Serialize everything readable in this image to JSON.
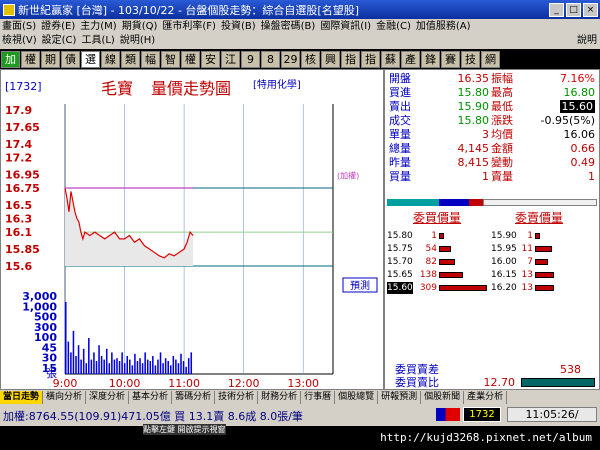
{
  "window": {
    "title": "新世紀贏家 [台灣] - 103/10/22 - 台盤個股走勢：綜合自選股[名望股]",
    "btn_min": "_",
    "btn_max": "□",
    "btn_close": "×"
  },
  "menu": {
    "row1": [
      "畫面(S)",
      "證券(E)",
      "主力(M)",
      "期貨(Q)",
      "匯市利率(F)",
      "投資(B)",
      "操盤密碼(B)",
      "國際資訊(I)",
      "金融(C)",
      "加值服務(A)"
    ],
    "row2": [
      "檢視(V)",
      "設定(C)",
      "工具(L)",
      "說明(H)"
    ],
    "help": "說明"
  },
  "toolbar": {
    "items": [
      "加",
      "權",
      "期",
      "債",
      "選",
      "線",
      "類",
      "幅",
      "智",
      "權",
      "安",
      "江",
      "9",
      "8",
      "29",
      "核",
      "興",
      "指",
      "指",
      "蘇",
      "產",
      "鋒",
      "賽",
      "技",
      "網"
    ],
    "selected_index": 4,
    "green_items": [
      0
    ]
  },
  "chart_area": {
    "stock_code": "[1732]",
    "stock_name": "毛寶",
    "chart_title": "量價走勢圖",
    "industry": "[特用化學]",
    "limit_up_label": "(加權)",
    "forecast_label": "預測",
    "vol_unit": "張"
  },
  "chart_data": {
    "type": "line",
    "price_axis": {
      "ticks": [
        17.9,
        17.65,
        17.4,
        17.2,
        16.95,
        16.75,
        16.5,
        16.3,
        16.1,
        15.85,
        15.6
      ],
      "ylim": [
        15.6,
        17.9
      ],
      "reference": 16.1,
      "limit_up_line": 16.75,
      "limit_down_line": 15.6
    },
    "volume_axis": {
      "ticks": [
        "3,000",
        "1,000",
        "500",
        "300",
        "100",
        "45",
        "30",
        "15"
      ],
      "ylim": [
        0,
        3000
      ]
    },
    "time_axis": {
      "ticks": [
        "9:00",
        "10:00",
        "11:00",
        "12:00",
        "13:00"
      ],
      "xlim": [
        "9:00",
        "13:30"
      ]
    },
    "series": [
      {
        "name": "price",
        "color": "#e00000",
        "x": [
          "9:00",
          "9:02",
          "9:04",
          "9:06",
          "9:08",
          "9:10",
          "9:12",
          "9:14",
          "9:16",
          "9:18",
          "9:20",
          "9:25",
          "9:30",
          "9:35",
          "9:40",
          "9:45",
          "9:50",
          "9:55",
          "10:00",
          "10:05",
          "10:10",
          "10:15",
          "10:20",
          "10:25",
          "10:30",
          "10:35",
          "10:40",
          "10:45",
          "10:50",
          "10:55",
          "11:00",
          "11:03",
          "11:06",
          "11:09"
        ],
        "values": [
          16.75,
          16.6,
          16.4,
          16.7,
          16.55,
          16.4,
          16.3,
          16.25,
          16.1,
          16.0,
          16.1,
          16.05,
          16.1,
          16.05,
          16.0,
          16.05,
          16.1,
          16.0,
          16.0,
          16.05,
          15.95,
          16.0,
          15.9,
          15.85,
          15.8,
          15.75,
          15.72,
          15.78,
          15.75,
          15.8,
          15.85,
          15.95,
          16.1,
          16.05
        ]
      },
      {
        "name": "average",
        "color": "#c040c0",
        "x": [
          "9:00",
          "11:09"
        ],
        "values": [
          16.75,
          16.75
        ]
      }
    ],
    "volume": {
      "color": "#0000e0",
      "x_range": [
        "9:00",
        "11:09"
      ],
      "heights_rel": [
        1.0,
        0.45,
        0.3,
        0.6,
        0.25,
        0.4,
        0.2,
        0.35,
        0.15,
        0.5,
        0.2,
        0.3,
        0.18,
        0.4,
        0.25,
        0.2,
        0.35,
        0.15,
        0.3,
        0.2,
        0.22,
        0.18,
        0.3,
        0.15,
        0.25,
        0.2,
        0.12,
        0.28,
        0.18,
        0.22,
        0.15,
        0.3,
        0.2,
        0.18,
        0.25,
        0.12,
        0.2,
        0.3,
        0.15,
        0.22,
        0.18,
        0.12,
        0.25,
        0.2,
        0.15,
        0.28,
        0.18,
        0.1,
        0.22,
        0.3
      ]
    }
  },
  "quote": {
    "rows": [
      {
        "l1": "開盤",
        "v1": "16.35",
        "l2": "振幅",
        "v2": "7.16%",
        "c1": "#c00000",
        "c2": "#e00000"
      },
      {
        "l1": "買進",
        "v1": "15.80",
        "l2": "最高",
        "v2": "16.80",
        "c1": "#009000",
        "c2": "#009000"
      },
      {
        "l1": "賣出",
        "v1": "15.90",
        "l2": "最低",
        "v2": "15.60",
        "c1": "#009000",
        "c2": "#ffffff"
      },
      {
        "l1": "成交",
        "v1": "15.80",
        "l2": "漲跌",
        "v2": "-0.95(5%)",
        "c1": "#009000",
        "c2": "#000000"
      },
      {
        "l1": "單量",
        "v1": "3",
        "l2": "均價",
        "v2": "16.06",
        "c1": "#c00000",
        "c2": "#000000"
      },
      {
        "l1": "總量",
        "v1": "4,145",
        "l2": "金額",
        "v2": "0.66",
        "c1": "#c00000",
        "c2": "#c00000"
      },
      {
        "l1": "昨量",
        "v1": "8,415",
        "l2": "變動",
        "v2": "0.49",
        "c1": "#c00000",
        "c2": "#c00000"
      },
      {
        "l1": "買量",
        "v1": "1",
        "l2": "賣量",
        "v2": "1",
        "c1": "#c00000",
        "c2": "#c00000"
      }
    ]
  },
  "orderbook": {
    "hdr_bids": "委買價量",
    "hdr_asks": "委賣價量",
    "bids": [
      {
        "price": "15.80",
        "qty": "1",
        "bar": 0.02
      },
      {
        "price": "15.75",
        "qty": "54",
        "bar": 0.18
      },
      {
        "price": "15.70",
        "qty": "82",
        "bar": 0.28
      },
      {
        "price": "15.65",
        "qty": "138",
        "bar": 0.45
      },
      {
        "price": "15.60",
        "qty": "309",
        "bar": 1.0
      }
    ],
    "asks": [
      {
        "price": "15.90",
        "qty": "1",
        "bar": 0.03
      },
      {
        "price": "15.95",
        "qty": "11",
        "bar": 0.3
      },
      {
        "price": "16.00",
        "qty": "7",
        "bar": 0.2
      },
      {
        "price": "16.15",
        "qty": "13",
        "bar": 0.35
      },
      {
        "price": "16.20",
        "qty": "13",
        "bar": 0.35
      }
    ],
    "diff_label": "委買賣差",
    "diff_value": "538",
    "ratio_label": "委買賣比",
    "ratio_value": "12.70"
  },
  "status_tabs": [
    "當日走勢",
    "橫向分析",
    "深度分析",
    "基本分析",
    "籌碼分析",
    "技術分析",
    "財務分析",
    "行事曆",
    "個股總覽",
    "研報預測",
    "個股新聞",
    "產業分析"
  ],
  "status_line": {
    "ticker": "加權:8764.55(109.91)471.05億 買 13.1賣 8.6成 8.0張/筆",
    "code": "1732",
    "clock": "11:05:26/",
    "hint": "點擊左鍵 開啟提示視窗"
  },
  "watermark": "http://kujd3268.pixnet.net/album",
  "colors": {
    "price_up": "#e00000",
    "price_down": "#009000",
    "volume": "#0000e0",
    "axis_label": "#c00000",
    "accent_yellow": "#ffd700"
  }
}
